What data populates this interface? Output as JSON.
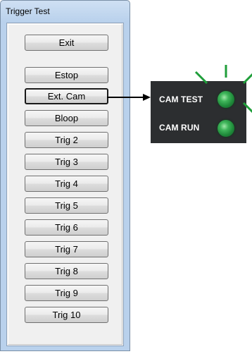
{
  "window": {
    "title": "Trigger Test"
  },
  "buttons": {
    "exit": "Exit",
    "estop": "Estop",
    "ext_cam": "Ext. Cam",
    "bloop": "Bloop",
    "trig2": "Trig 2",
    "trig3": "Trig 3",
    "trig4": "Trig 4",
    "trig5": "Trig 5",
    "trig6": "Trig 6",
    "trig7": "Trig 7",
    "trig8": "Trig 8",
    "trig9": "Trig 9",
    "trig10": "Trig 10"
  },
  "cam_panel": {
    "test_label": "CAM TEST",
    "run_label": "CAM RUN",
    "test_led_state": "lit",
    "run_led_state": "off",
    "led_color": "#2e9e48",
    "ray_color": "#1f9e3a",
    "panel_color": "#2c2e30"
  },
  "icons": {
    "arrow": "arrow-right-icon",
    "led": "indicator-light-icon"
  }
}
